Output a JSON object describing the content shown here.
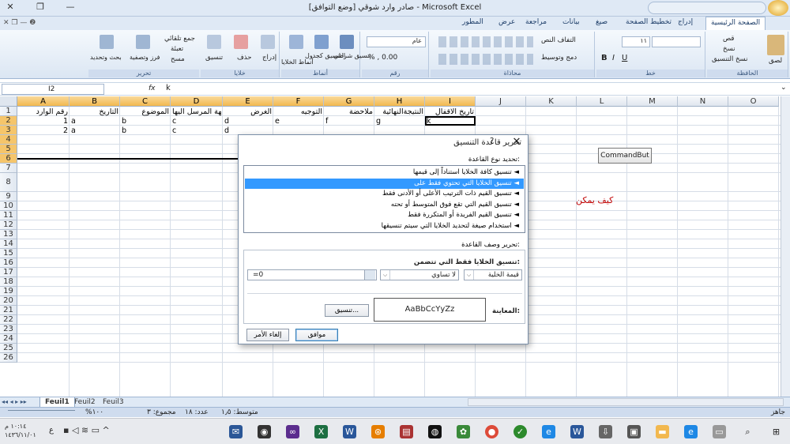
{
  "window": {
    "title": "صادر وارد شوقي  [وضع التوافق] - Microsoft Excel"
  },
  "ribbon": {
    "tabs": [
      "الصفحة الرئيسية",
      "إدراج",
      "تخطيط الصفحة",
      "صيغ",
      "بيانات",
      "مراجعة",
      "عرض",
      "المطور"
    ],
    "groups": {
      "clipboard": {
        "label": "الحافظة",
        "paste": "لصق",
        "cut": "قص",
        "copy": "نسخ",
        "format_painter": "نسخ التنسيق"
      },
      "font": {
        "label": "خط",
        "font_name": "",
        "font_size": "١١"
      },
      "alignment": {
        "label": "محاذاة",
        "wrap": "التفاف النص",
        "merge": "دمج وتوسيط"
      },
      "number": {
        "label": "رقم",
        "format": "عام"
      },
      "styles": {
        "label": "أنماط",
        "conditional": "تنسيق شرطي",
        "as_table": "التنسيق كجدول",
        "cell_styles": "أنماط الخلايا"
      },
      "cells": {
        "label": "خلايا",
        "insert": "إدراج",
        "delete": "حذف",
        "format": "تنسيق"
      },
      "editing": {
        "label": "تحرير",
        "autosum": "جمع تلقائي",
        "fill": "تعبئة",
        "clear": "مسح",
        "sort": "فرز وتصفية",
        "find": "بحث وتحديد"
      }
    }
  },
  "formula_bar": {
    "name_box": "I2",
    "fx": "fx",
    "content": "k"
  },
  "columns": [
    "A",
    "B",
    "C",
    "D",
    "E",
    "F",
    "G",
    "H",
    "I",
    "J",
    "K",
    "L",
    "M",
    "N",
    "O"
  ],
  "rows": [
    "1",
    "2",
    "3",
    "4",
    "5",
    "6",
    "7",
    "8",
    "9",
    "10",
    "11",
    "12",
    "13",
    "14",
    "15",
    "16",
    "17",
    "18",
    "19",
    "20",
    "21",
    "22",
    "23",
    "24",
    "25",
    "26"
  ],
  "cells": {
    "header": [
      "رقم الوارد",
      "التاريخ",
      "الموضوع",
      "الجهة المرسل اليها",
      "الغرض",
      "التوجيه",
      "ملاحضة",
      "النتيجةالنهائية",
      "تاريخ الاقفال"
    ],
    "row2": [
      "1",
      "a",
      "b",
      "c",
      "d",
      "e",
      "f",
      "g",
      "k"
    ],
    "row3": [
      "2",
      "a",
      "b",
      "c",
      "d"
    ],
    "side_text": "كيف يمكن",
    "command_button": "CommandBut"
  },
  "sheet_tabs": [
    "Feuil1",
    "Feuil2",
    "Feuil3"
  ],
  "status": {
    "mode": "جاهز",
    "average": "متوسط: ١٫٥",
    "count": "عدد: ١٨",
    "sum": "مجموع: ٣",
    "zoom": "%١٠٠"
  },
  "dialog": {
    "title": "تحرير قاعدة التنسيق",
    "help": "?",
    "close": "✕",
    "select_rule_type": "تحديد نوع القاعدة:",
    "rule_types": [
      "تنسيق كافة الخلايا استناداً إلى قيمها",
      "تنسيق الخلايا التي تحتوي فقط على",
      "تنسيق القيم ذات الترتيب الأعلى أو الأدنى فقط",
      "تنسيق القيم التي تقع فوق المتوسط أو تحته",
      "تنسيق القيم الفريدة أو المتكررة فقط",
      "استخدام صيغة لتحديد الخلايا التي سيتم تنسيقها"
    ],
    "edit_description": "تحرير وصف القاعدة:",
    "format_only_cells": "تنسيق الخلايا فقط التي تتضمن:",
    "condition1": "قيمة الخلية",
    "condition2": "لا تساوي",
    "value": "=0",
    "preview_label": "المعاينة:",
    "preview_text": "AaBbCcYyZz",
    "format_button": "تنسيق...",
    "ok": "موافق",
    "cancel": "إلغاء الأمر"
  },
  "taskbar": {
    "time": "١٠:١٤ م",
    "date": "١٤٣٦/١١/٠١",
    "lang": "ع"
  }
}
